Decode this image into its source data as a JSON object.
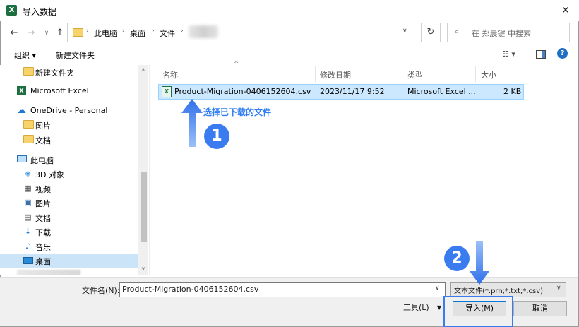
{
  "window": {
    "title": "导入数据",
    "app_icon": "excel-icon",
    "close_glyph": "✕"
  },
  "address": {
    "crumbs": [
      "此电脑",
      "桌面",
      "文件"
    ],
    "search_placeholder": "在 郑晨键 中搜索"
  },
  "toolbar": {
    "organize": "组织 ▾",
    "new_folder": "新建文件夹"
  },
  "sidebar": {
    "items": [
      {
        "label": "新建文件夹",
        "icon": "folder-icon"
      },
      {
        "label": "Microsoft Excel",
        "icon": "excel-icon"
      },
      {
        "label": "OneDrive - Personal",
        "icon": "cloud-icon"
      },
      {
        "label": "图片",
        "icon": "folder-icon"
      },
      {
        "label": "文档",
        "icon": "folder-icon"
      },
      {
        "label": "此电脑",
        "icon": "computer-icon"
      },
      {
        "label": "3D 对象",
        "icon": "cube-icon"
      },
      {
        "label": "视频",
        "icon": "video-icon"
      },
      {
        "label": "图片",
        "icon": "picture-icon"
      },
      {
        "label": "文档",
        "icon": "document-icon"
      },
      {
        "label": "下载",
        "icon": "download-icon"
      },
      {
        "label": "音乐",
        "icon": "music-icon"
      },
      {
        "label": "桌面",
        "icon": "desktop-icon"
      }
    ]
  },
  "file_list": {
    "columns": [
      "名称",
      "修改日期",
      "类型",
      "大小"
    ],
    "rows": [
      {
        "name": "Product-Migration-0406152604.csv",
        "date": "2023/11/17 9:52",
        "type": "Microsoft Excel ...",
        "size": "2 KB"
      }
    ]
  },
  "annotations": {
    "step1_label": "选择已下载的文件",
    "step1_number": "1",
    "step2_number": "2",
    "accent_color": "#3a7bef"
  },
  "bottom": {
    "filename_label": "文件名(N):",
    "filename_value": "Product-Migration-0406152604.csv",
    "filter_value": "文本文件(*.prn;*.txt;*.csv)",
    "tools_label": "工具(L)",
    "import_label": "导入(M)",
    "cancel_label": "取消"
  }
}
